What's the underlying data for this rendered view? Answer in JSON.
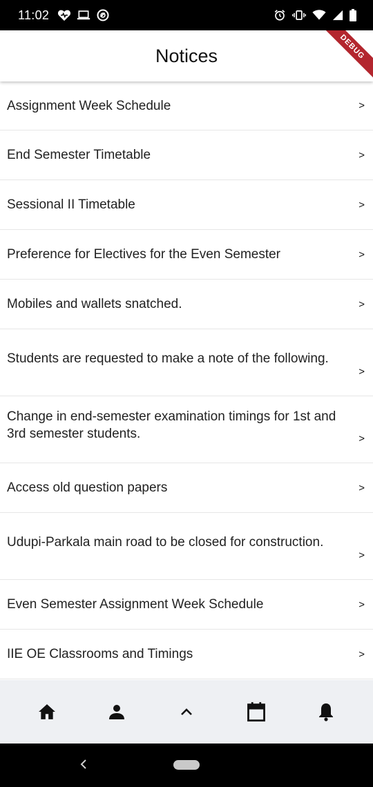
{
  "status_bar": {
    "time": "11:02",
    "left_icons": [
      "heart-icon",
      "laptop-icon",
      "data-saver-icon"
    ],
    "right_icons": [
      "alarm-icon",
      "vibrate-icon",
      "wifi-icon",
      "signal-icon",
      "battery-icon"
    ]
  },
  "app_bar": {
    "title": "Notices",
    "debug_label": "DEBUG"
  },
  "notices": [
    {
      "title": "Assignment Week Schedule",
      "chevron": ">"
    },
    {
      "title": "End Semester Timetable",
      "chevron": ">"
    },
    {
      "title": "Sessional II Timetable",
      "chevron": ">"
    },
    {
      "title": "Preference for Electives for the Even Semester",
      "chevron": ">"
    },
    {
      "title": "Mobiles and wallets snatched.",
      "chevron": ">"
    },
    {
      "title": "Students are requested to make a note of the following.",
      "chevron": ">"
    },
    {
      "title": "Change in end-semester examination timings for 1st and 3rd semester students.",
      "chevron": ">"
    },
    {
      "title": "Access old question papers",
      "chevron": ">"
    },
    {
      "title": "Udupi-Parkala main road to be closed for construction.",
      "chevron": ">"
    },
    {
      "title": "Even Semester Assignment Week Schedule",
      "chevron": ">"
    },
    {
      "title": "IIE OE Classrooms and Timings",
      "chevron": ">"
    }
  ],
  "bottom_nav": {
    "items": [
      "home-icon",
      "person-icon",
      "chevron-up-icon",
      "calendar-icon",
      "bell-icon"
    ]
  },
  "system_nav": {
    "items": [
      "back-icon",
      "home-pill"
    ]
  },
  "colors": {
    "status_bar_bg": "#000000",
    "app_bar_bg": "#ffffff",
    "bottom_nav_bg": "#eef0f3",
    "debug_ribbon": "#b3262e"
  }
}
